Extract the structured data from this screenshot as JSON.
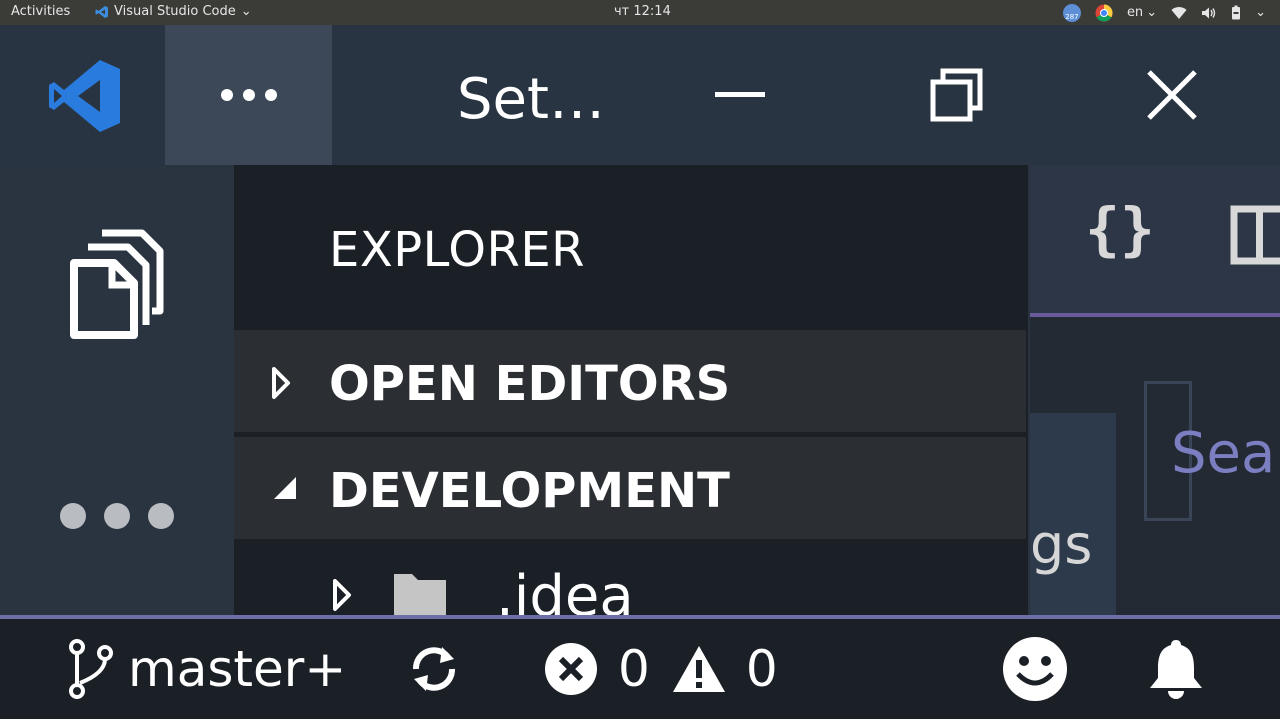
{
  "topbar": {
    "activities": "Activities",
    "app_name": "Visual Studio Code",
    "clock": "чт 12:14",
    "badge_count": "287",
    "language": "en"
  },
  "titlebar": {
    "title": "Set…",
    "menu_icon": "more-horizontal-icon"
  },
  "activitybar": {
    "items": [
      "files-icon",
      "more-icon"
    ]
  },
  "explorer": {
    "title": "EXPLORER",
    "sections": [
      {
        "label": "OPEN EDITORS",
        "expanded": false
      },
      {
        "label": "DEVELOPMENT",
        "expanded": true
      }
    ],
    "tree": [
      {
        "name": ".idea",
        "type": "folder",
        "expanded": false
      }
    ]
  },
  "editor": {
    "tab_fragment": "gs",
    "search_fragment": "Sear"
  },
  "statusbar": {
    "branch": "master+",
    "errors": "0",
    "warnings": "0"
  },
  "colors": {
    "vscode_blue": "#2a7bde",
    "status_accent": "#6f6fa8",
    "sidebar_bg": "#1b2027",
    "section_bg": "#2b2f33"
  }
}
